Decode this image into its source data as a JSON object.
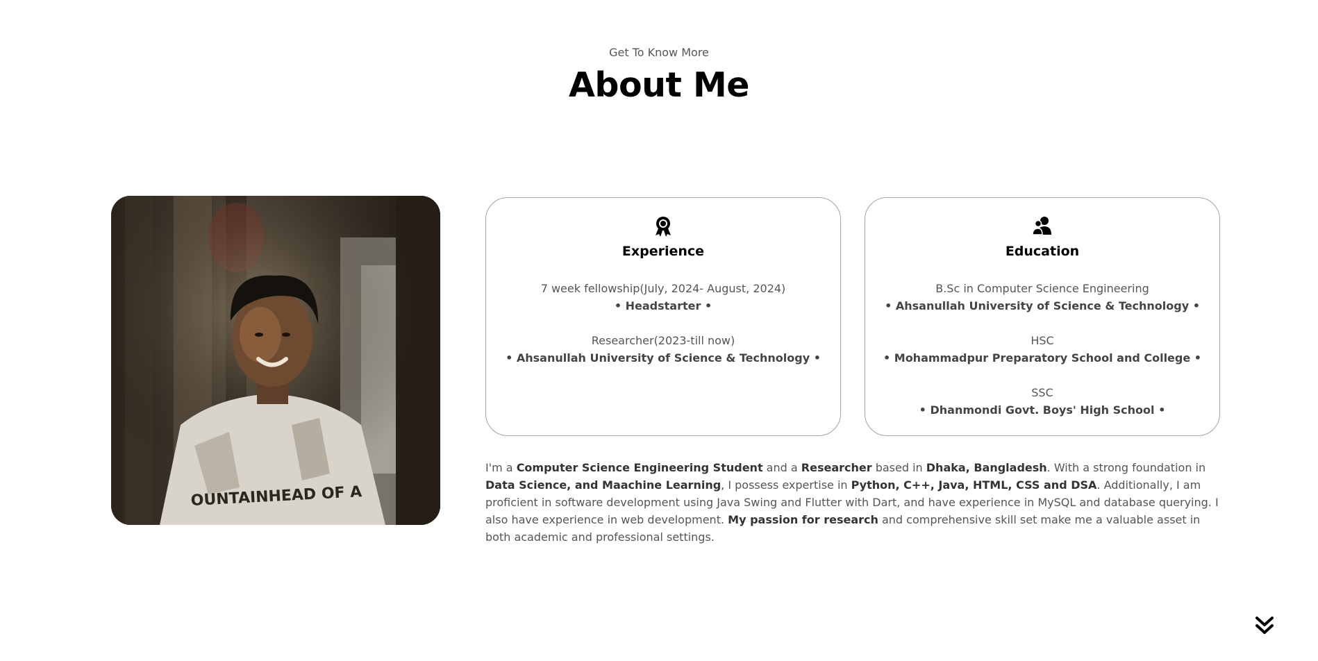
{
  "header": {
    "subtitle": "Get To Know More",
    "title": "About Me"
  },
  "experience": {
    "icon": "award-icon",
    "title": "Experience",
    "items": [
      {
        "line1": "7 week fellowship(July, 2024- August, 2024)",
        "line2": "• Headstarter •"
      },
      {
        "line1": "Researcher(2023-till now)",
        "line2": "• Ahsanullah University of Science & Technology •"
      }
    ]
  },
  "education": {
    "icon": "users-icon",
    "title": "Education",
    "items": [
      {
        "line1": "B.Sc in Computer Science Engineering",
        "line2": "• Ahsanullah University of Science & Technology •"
      },
      {
        "line1": "HSC",
        "line2": "• Mohammadpur Preparatory School and College •"
      },
      {
        "line1": "SSC",
        "line2": "• Dhanmondi Govt. Boys' High School •"
      }
    ]
  },
  "bio": {
    "p1": "I'm a ",
    "b1": "Computer Science Engineering Student",
    "p2": " and a ",
    "b2": "Researcher",
    "p3": " based in ",
    "b3": "Dhaka, Bangladesh",
    "p4": ". With a strong foundation in ",
    "b4": "Data Science, and Maachine Learning",
    "p5": ", I possess expertise in ",
    "b5": "Python, C++, Java, HTML, CSS and DSA",
    "p6": ". Additionally, I am proficient in software development using Java Swing and Flutter with Dart, and have experience in MySQL and database querying. I also have experience in web development. ",
    "b6": "My passion for research",
    "p7": " and comprehensive skill set make me a valuable asset in both academic and professional settings."
  },
  "nav": {
    "arrow_icon": "double-chevron-down-icon"
  },
  "colors": {
    "title": "#000000",
    "text": "#555555",
    "card_border": "#a3a3a3"
  }
}
